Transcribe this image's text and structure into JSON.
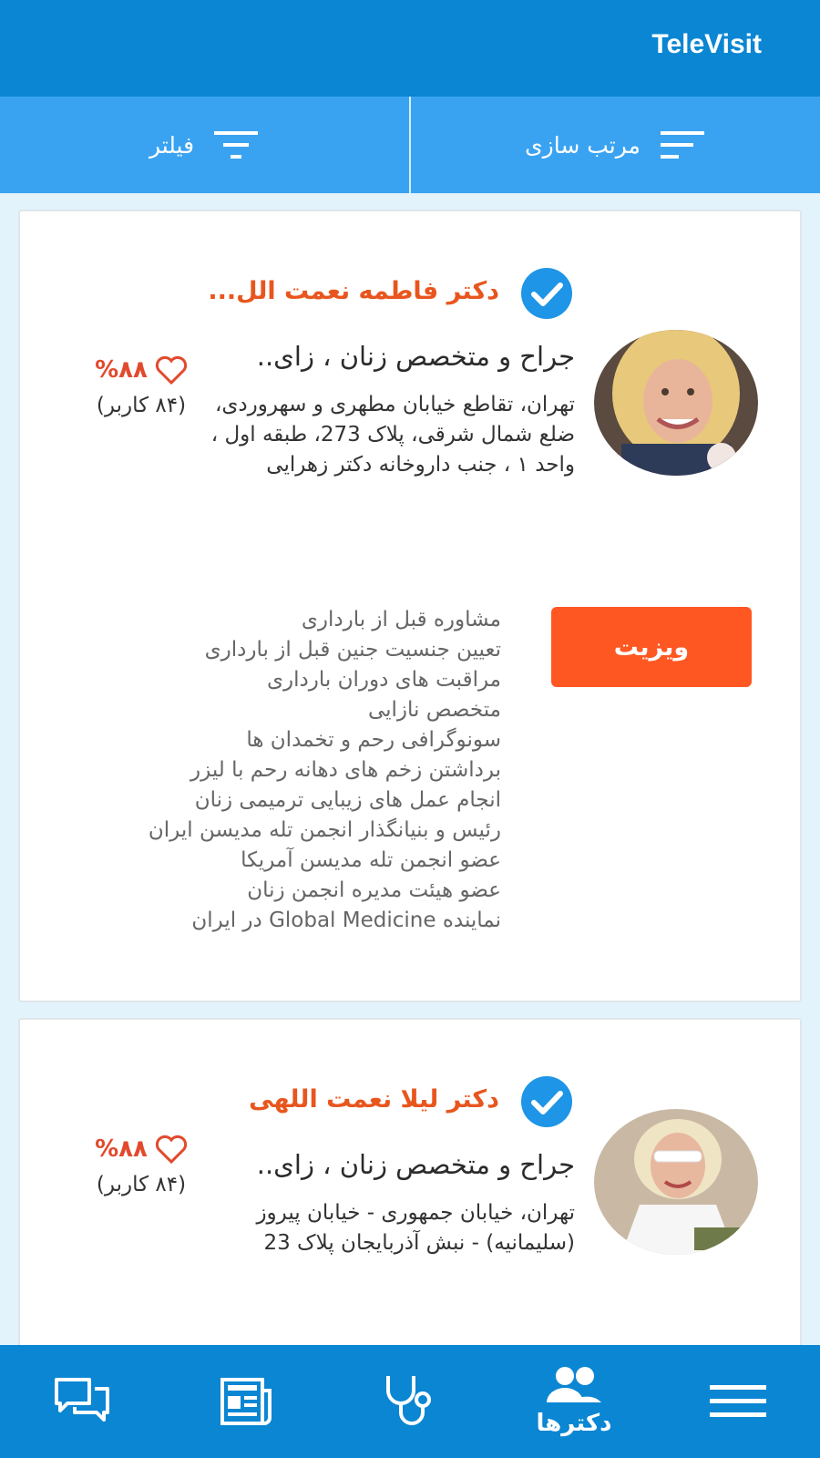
{
  "header": {
    "title": "TeleVisit"
  },
  "toolbar": {
    "sort_label": "مرتب سازی",
    "filter_label": "فیلتر"
  },
  "doctors": [
    {
      "name": "دکتر فاطمه نعمت الل...",
      "specialty": "جراح و متخصص زنان ، زای..",
      "address": "تهران، تقاطع خیابان مطهری و سهروردی، ضلع شمال شرقی، پلاک 273، طبقه اول ، واحد ۱ ، جنب داروخانه دکتر زهرایی",
      "rating": "%۸۸",
      "users": "(۸۴ کاربر)",
      "visit_label": "ویزیت",
      "services": [
        "مشاوره قبل از بارداری",
        "تعیین جنسیت جنین قبل از بارداری",
        "مراقبت های دوران بارداری",
        "متخصص نازایی",
        "سونوگرافی رحم و تخمدان ها",
        "برداشتن زخم های دهانه رحم با لیزر",
        "انجام عمل های زیبایی ترمیمی زنان",
        "رئیس و بنیانگذار انجمن تله مدیسن ایران",
        "عضو انجمن تله مدیسن آمریکا",
        "عضو هیئت مدیره انجمن زنان",
        "نماینده Global Medicine  در ایران"
      ]
    },
    {
      "name": "دکتر لیلا نعمت اللهی",
      "specialty": "جراح و متخصص زنان ، زای..",
      "address": "تهران، خیابان جمهوری - خیابان پیروز (سلیمانیه) - نبش آذربایجان پلاک 23",
      "rating": "%۸۸",
      "users": "(۸۴ کاربر)"
    }
  ],
  "bottom_nav": {
    "doctors_label": "دکترها"
  },
  "colors": {
    "primary": "#0a86d3",
    "toolbar": "#3aa3f1",
    "accent": "#ff5722",
    "name": "#e8561e"
  }
}
